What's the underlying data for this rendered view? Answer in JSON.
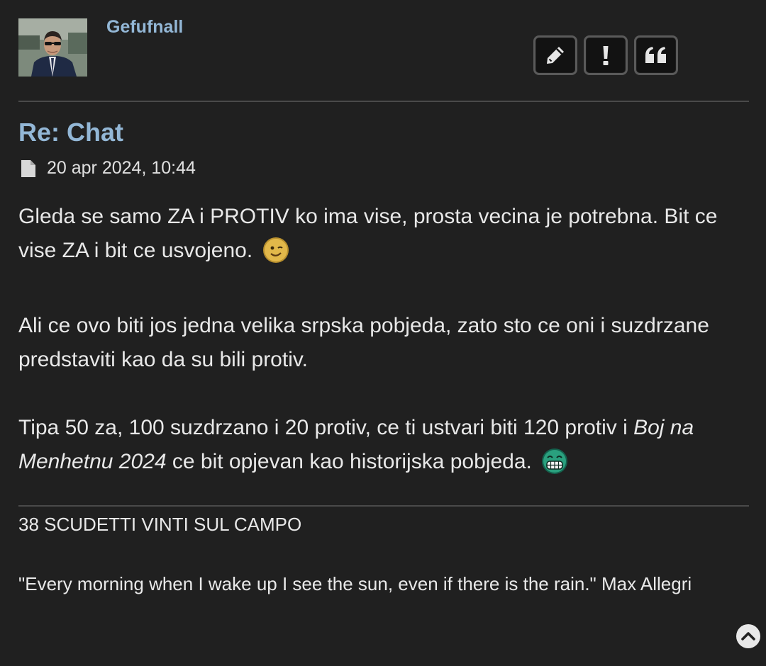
{
  "author": {
    "username": "Gefufnall",
    "avatar_icon": "user-avatar-photo"
  },
  "actions": [
    {
      "name": "edit",
      "icon": "pencil-icon"
    },
    {
      "name": "report",
      "icon": "exclamation-icon"
    },
    {
      "name": "quote",
      "icon": "quote-icon"
    }
  ],
  "post": {
    "title": "Re: Chat",
    "date": "20 apr 2024, 10:44",
    "post_icon": "file-icon",
    "paragraph1": "Gleda se samo ZA i PROTIV ko ima vise, prosta vecina je potrebna. Bit ce vise ZA i bit ce usvojeno.",
    "smiley1": "wink-smiley",
    "paragraph2": "Ali ce ovo biti jos jedna velika srpska pobjeda, zato sto ce oni i suzdrzane predstaviti kao da su bili protiv.",
    "paragraph3_start": "Tipa 50 za, 100 suzdrzano i 20 protiv, ce ti ustvari biti 120 protiv i",
    "paragraph3_italic": "Boj na Menhetnu 2024",
    "paragraph3_end": "ce bit opjevan kao historijska pobjeda.",
    "smiley2": "grin-smiley"
  },
  "signature": {
    "line1": "38 SCUDETTI VINTI SUL CAMPO",
    "quote": "\"Every morning when I wake up I see the sun, even if there is the rain.\" Max Allegri"
  },
  "colors": {
    "background": "#202020",
    "link": "#93b7d6",
    "text": "#e8e8e8"
  }
}
